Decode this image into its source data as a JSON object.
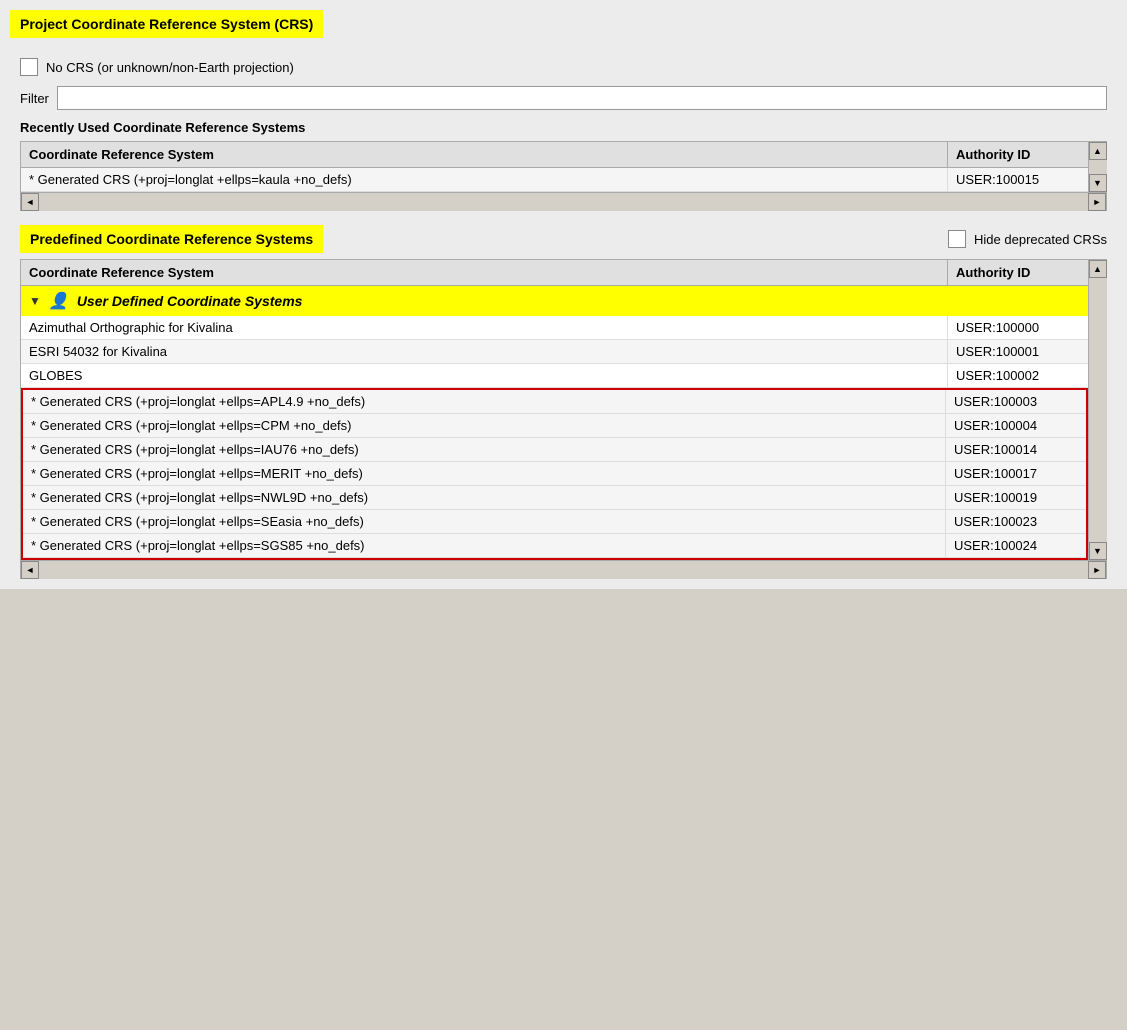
{
  "page": {
    "title": "Project Coordinate Reference System (CRS)"
  },
  "no_crs": {
    "label": "No CRS (or unknown/non-Earth projection)"
  },
  "filter": {
    "label": "Filter",
    "placeholder": ""
  },
  "recently_used": {
    "label": "Recently Used Coordinate Reference Systems",
    "columns": {
      "crs": "Coordinate Reference System",
      "auth": "Authority ID"
    },
    "rows": [
      {
        "crs": "* Generated CRS (+proj=longlat +ellps=kaula +no_defs)",
        "auth": "USER:100015"
      }
    ]
  },
  "predefined": {
    "label": "Predefined Coordinate Reference Systems",
    "hide_deprecated_label": "Hide deprecated CRSs",
    "columns": {
      "crs": "Coordinate Reference System",
      "auth": "Authority ID"
    },
    "group": {
      "label": "User Defined Coordinate Systems"
    },
    "rows": [
      {
        "crs": "Azimuthal Orthographic for Kivalina",
        "auth": "USER:100000",
        "highlighted": false
      },
      {
        "crs": "ESRI 54032 for Kivalina",
        "auth": "USER:100001",
        "highlighted": false
      },
      {
        "crs": "GLOBES",
        "auth": "USER:100002",
        "highlighted": false
      },
      {
        "crs": "* Generated CRS (+proj=longlat +ellps=APL4.9 +no_defs)",
        "auth": "USER:100003",
        "highlighted": true
      },
      {
        "crs": "* Generated CRS (+proj=longlat +ellps=CPM +no_defs)",
        "auth": "USER:100004",
        "highlighted": true
      },
      {
        "crs": "* Generated CRS (+proj=longlat +ellps=IAU76 +no_defs)",
        "auth": "USER:100014",
        "highlighted": true
      },
      {
        "crs": "* Generated CRS (+proj=longlat +ellps=MERIT +no_defs)",
        "auth": "USER:100017",
        "highlighted": true
      },
      {
        "crs": "* Generated CRS (+proj=longlat +ellps=NWL9D +no_defs)",
        "auth": "USER:100019",
        "highlighted": true
      },
      {
        "crs": "* Generated CRS (+proj=longlat +ellps=SEasia +no_defs)",
        "auth": "USER:100023",
        "highlighted": true
      },
      {
        "crs": "* Generated CRS (+proj=longlat +ellps=SGS85 +no_defs)",
        "auth": "USER:100024",
        "highlighted": true
      }
    ]
  },
  "icons": {
    "up_arrow": "▲",
    "down_arrow": "▼",
    "left_arrow": "◄",
    "right_arrow": "►",
    "triangle_down": "▼",
    "user": "👤"
  }
}
